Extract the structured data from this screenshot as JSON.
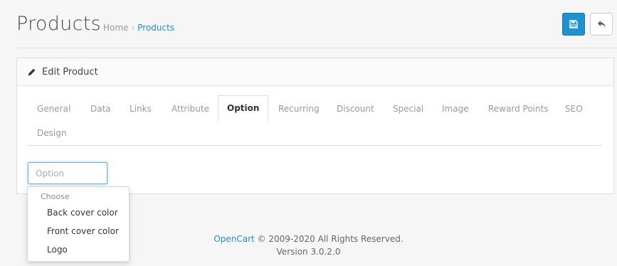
{
  "header": {
    "title": "Products",
    "breadcrumb": [
      "Home",
      "Products"
    ],
    "save_icon": "floppy-disk-icon",
    "back_icon": "reply-arrow-icon",
    "accent_color": "#1e91cf"
  },
  "panel": {
    "heading": "Edit Product",
    "heading_icon": "pencil-icon"
  },
  "tabs": [
    {
      "label": "General"
    },
    {
      "label": "Data"
    },
    {
      "label": "Links"
    },
    {
      "label": "Attribute"
    },
    {
      "label": "Option",
      "active": true
    },
    {
      "label": "Recurring"
    },
    {
      "label": "Discount"
    },
    {
      "label": "Special"
    },
    {
      "label": "Image"
    },
    {
      "label": "Reward Points"
    },
    {
      "label": "SEO"
    },
    {
      "label": "Design"
    }
  ],
  "option_input": {
    "placeholder": "Option",
    "value": ""
  },
  "dropdown": {
    "header": "Choose",
    "items": [
      "Back cover color",
      "Front cover color",
      "Logo"
    ]
  },
  "footer": {
    "link": "OpenCart",
    "copyright": " © 2009-2020 All Rights Reserved.",
    "version": "Version 3.0.2.0"
  }
}
